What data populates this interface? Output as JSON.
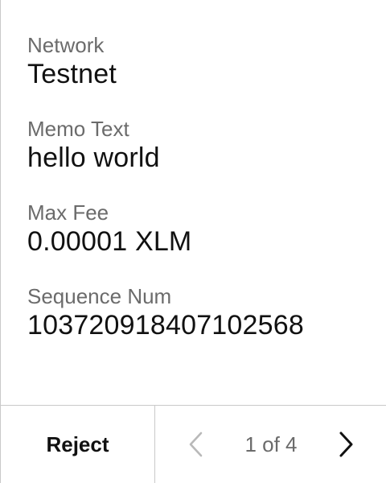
{
  "fields": [
    {
      "label": "Network",
      "value": "Testnet"
    },
    {
      "label": "Memo Text",
      "value": "hello world"
    },
    {
      "label": "Max Fee",
      "value": "0.00001 XLM"
    },
    {
      "label": "Sequence Num",
      "value": "103720918407102568"
    }
  ],
  "footer": {
    "reject_label": "Reject",
    "page_indicator": "1 of 4",
    "prev_icon": "chevron-left-icon",
    "next_icon": "chevron-right-icon"
  },
  "colors": {
    "label": "#6b6b6b",
    "value": "#111111",
    "divider": "#c9c9c9",
    "prev_disabled": "#b9b9b9",
    "next_active": "#111111"
  }
}
